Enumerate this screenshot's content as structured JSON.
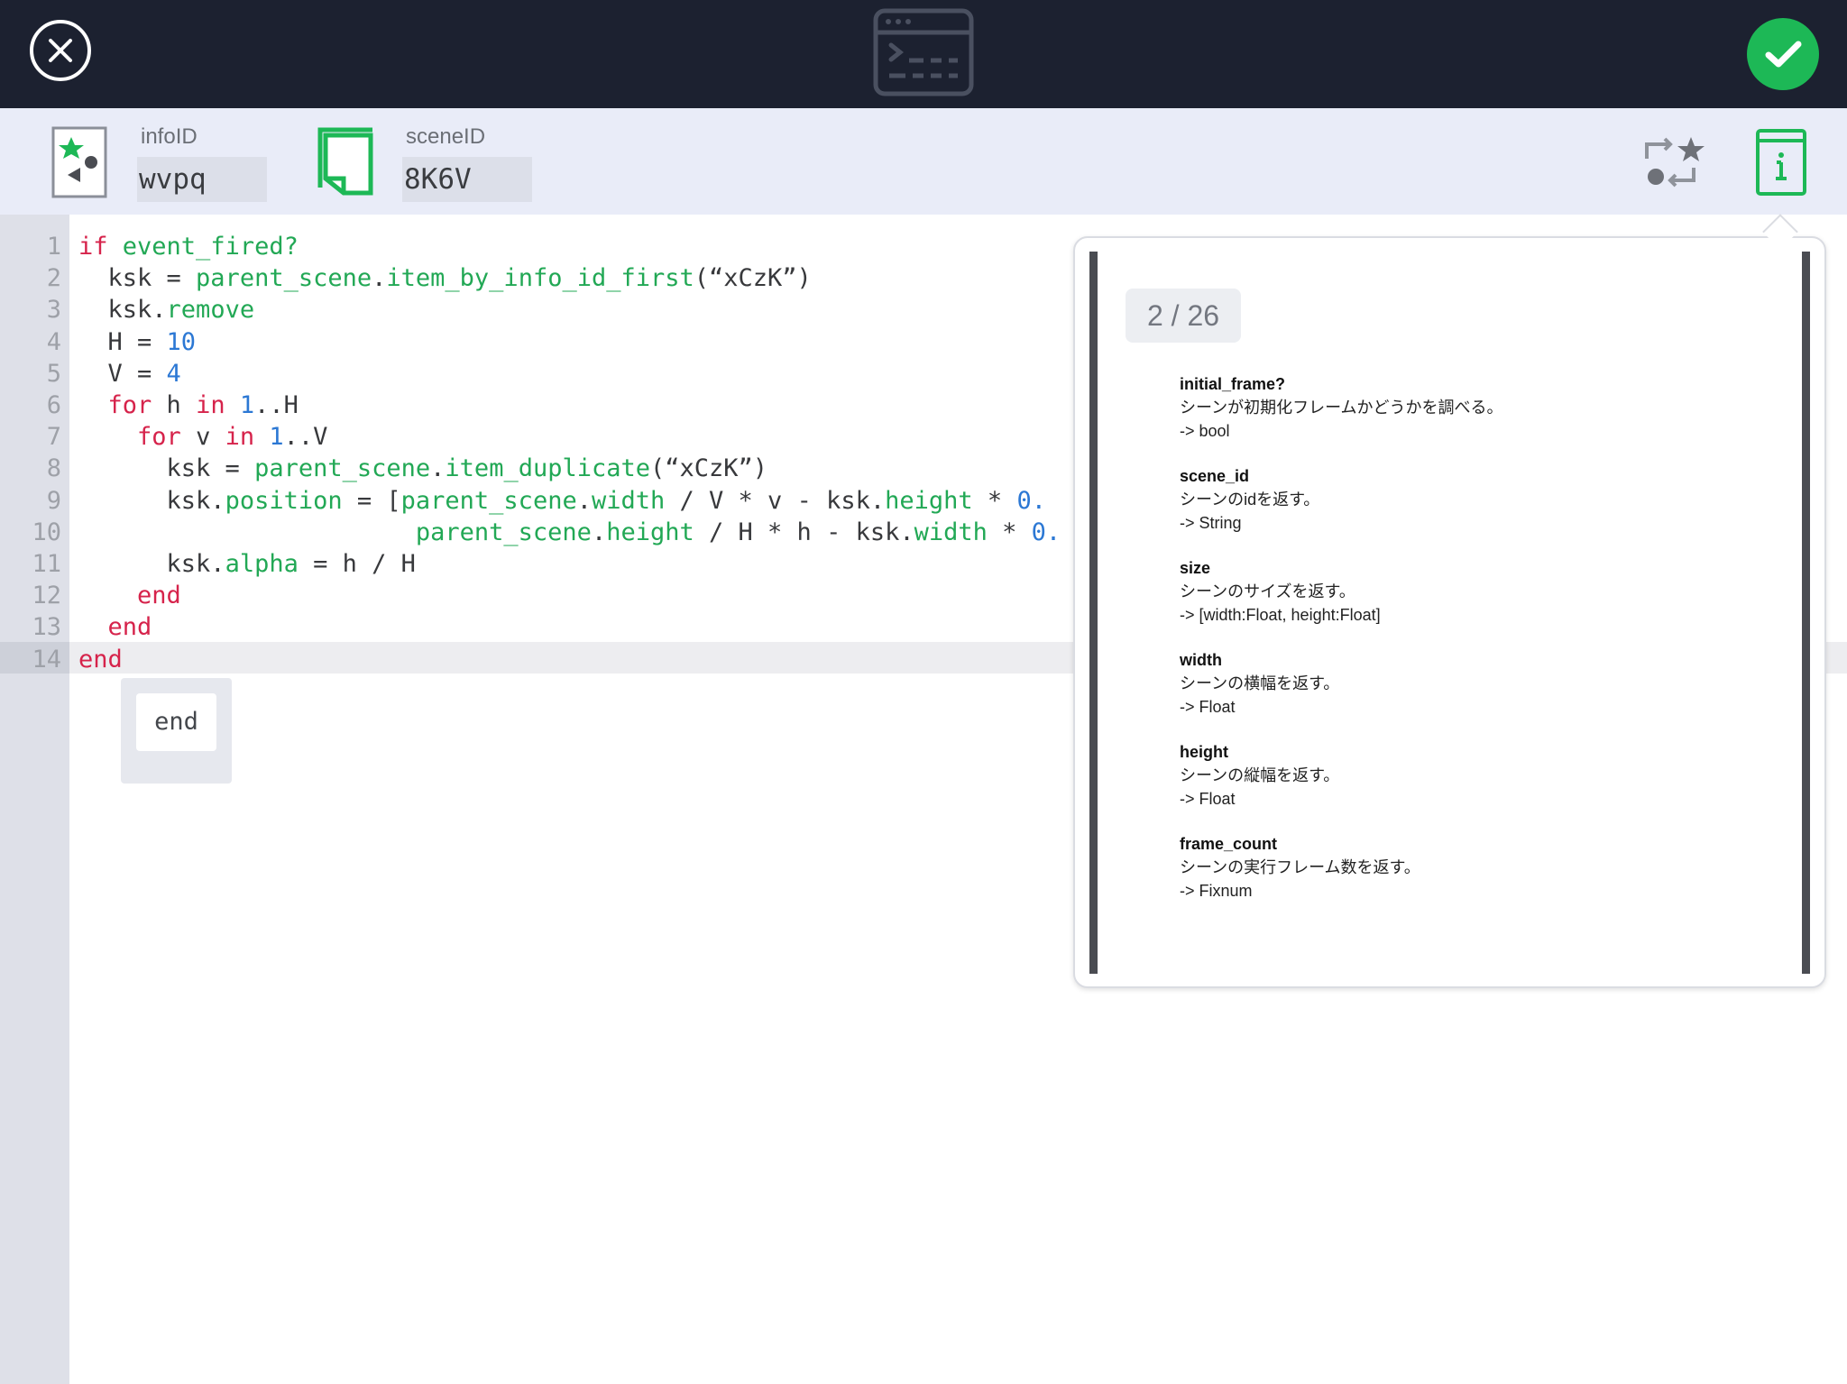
{
  "toolbar": {
    "close_icon": "close-circle-icon",
    "center_icon": "terminal-window-icon",
    "done_icon": "checkmark-icon",
    "done_color": "#1db856"
  },
  "ids": {
    "info_label": "infoID",
    "info_value": "wvpq",
    "scene_label": "sceneID",
    "scene_value": "8K6V"
  },
  "editor": {
    "current_line": 14,
    "line_numbers": [
      "1",
      "2",
      "3",
      "4",
      "5",
      "6",
      "7",
      "8",
      "9",
      "10",
      "11",
      "12",
      "13",
      "14"
    ],
    "lines": [
      {
        "parts": [
          [
            "k",
            "if"
          ],
          [
            "p",
            " "
          ],
          [
            "m",
            "event_fired?"
          ]
        ]
      },
      {
        "parts": [
          [
            "p",
            "  ksk = "
          ],
          [
            "m",
            "parent_scene"
          ],
          [
            "p",
            "."
          ],
          [
            "m",
            "item_by_info_id_first"
          ],
          [
            "p",
            "(“xCzK”)"
          ]
        ]
      },
      {
        "parts": [
          [
            "p",
            "  ksk."
          ],
          [
            "m",
            "remove"
          ]
        ]
      },
      {
        "parts": [
          [
            "p",
            "  H = "
          ],
          [
            "n",
            "10"
          ]
        ]
      },
      {
        "parts": [
          [
            "p",
            "  V = "
          ],
          [
            "n",
            "4"
          ]
        ]
      },
      {
        "parts": [
          [
            "p",
            "  "
          ],
          [
            "k",
            "for"
          ],
          [
            "p",
            " h "
          ],
          [
            "k",
            "in"
          ],
          [
            "p",
            " "
          ],
          [
            "n",
            "1"
          ],
          [
            "p",
            "..H"
          ]
        ]
      },
      {
        "parts": [
          [
            "p",
            "    "
          ],
          [
            "k",
            "for"
          ],
          [
            "p",
            " v "
          ],
          [
            "k",
            "in"
          ],
          [
            "p",
            " "
          ],
          [
            "n",
            "1"
          ],
          [
            "p",
            "..V"
          ]
        ]
      },
      {
        "parts": [
          [
            "p",
            "      ksk = "
          ],
          [
            "m",
            "parent_scene"
          ],
          [
            "p",
            "."
          ],
          [
            "m",
            "item_duplicate"
          ],
          [
            "p",
            "(“xCzK”)"
          ]
        ]
      },
      {
        "parts": [
          [
            "p",
            "      ksk."
          ],
          [
            "m",
            "position"
          ],
          [
            "p",
            " = ["
          ],
          [
            "m",
            "parent_scene"
          ],
          [
            "p",
            "."
          ],
          [
            "m",
            "width"
          ],
          [
            "p",
            " / V * v - ksk."
          ],
          [
            "m",
            "height"
          ],
          [
            "p",
            " * "
          ],
          [
            "n",
            "0."
          ]
        ]
      },
      {
        "parts": [
          [
            "p",
            "                       "
          ],
          [
            "m",
            "parent_scene"
          ],
          [
            "p",
            "."
          ],
          [
            "m",
            "height"
          ],
          [
            "p",
            " / H * h - ksk."
          ],
          [
            "m",
            "width"
          ],
          [
            "p",
            " * "
          ],
          [
            "n",
            "0."
          ]
        ]
      },
      {
        "parts": [
          [
            "p",
            "      ksk."
          ],
          [
            "m",
            "alpha"
          ],
          [
            "p",
            " = h / H"
          ]
        ]
      },
      {
        "parts": [
          [
            "p",
            "    "
          ],
          [
            "k",
            "end"
          ]
        ]
      },
      {
        "parts": [
          [
            "p",
            "  "
          ],
          [
            "k",
            "end"
          ]
        ]
      },
      {
        "parts": [
          [
            "k",
            "end"
          ]
        ]
      }
    ],
    "autocomplete": "end"
  },
  "reference": {
    "page": "2 / 26",
    "entries": [
      {
        "name": "initial_frame?",
        "desc": "シーンが初期化フレームかどうかを調べる。",
        "ret": "-> bool"
      },
      {
        "name": "scene_id",
        "desc": "シーンのidを返す。",
        "ret": "-> String"
      },
      {
        "name": "size",
        "desc": "シーンのサイズを返す。",
        "ret": "-> [width:Float, height:Float]"
      },
      {
        "name": "width",
        "desc": "シーンの横幅を返す。",
        "ret": "-> Float"
      },
      {
        "name": "height",
        "desc": "シーンの縦幅を返す。",
        "ret": "-> Float"
      },
      {
        "name": "frame_count",
        "desc": "シーンの実行フレーム数を返す。",
        "ret": "-> Fixnum"
      }
    ]
  },
  "colors": {
    "topbar": "#1c2130",
    "keyword": "#d6234b",
    "method": "#22a855",
    "number": "#2c78d4",
    "icon_green": "#1db856"
  }
}
